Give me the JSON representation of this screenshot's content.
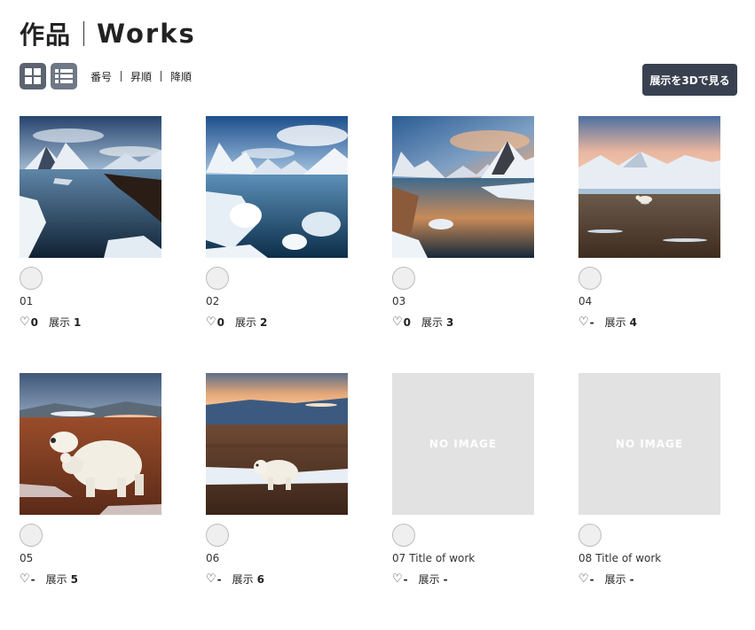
{
  "header": {
    "title_jp": "作品",
    "title_en": "Works"
  },
  "toolbar": {
    "grid_view_icon": "grid-icon",
    "list_view_icon": "list-icon",
    "sort_options": [
      "番号",
      "昇順",
      "降順"
    ],
    "view_3d_label": "展示を3Dで見る"
  },
  "works": [
    {
      "number": "01",
      "title": "",
      "likes": "0",
      "exhibit_label": "展示",
      "exhibit": "1",
      "image": "icy-lake-mountains"
    },
    {
      "number": "02",
      "title": "",
      "likes": "0",
      "exhibit_label": "展示",
      "exhibit": "2",
      "image": "ice-floes-mountains"
    },
    {
      "number": "03",
      "title": "",
      "likes": "0",
      "exhibit_label": "展示",
      "exhibit": "3",
      "image": "sunset-lake-mountains"
    },
    {
      "number": "04",
      "title": "",
      "likes": "-",
      "exhibit_label": "展示",
      "exhibit": "4",
      "image": "polar-bear-tundra"
    },
    {
      "number": "05",
      "title": "",
      "likes": "-",
      "exhibit_label": "展示",
      "exhibit": "5",
      "image": "polar-bear-mother-cub"
    },
    {
      "number": "06",
      "title": "",
      "likes": "-",
      "exhibit_label": "展示",
      "exhibit": "6",
      "image": "polar-bear-dusk"
    },
    {
      "number": "07",
      "title": "Title of work",
      "likes": "-",
      "exhibit_label": "展示",
      "exhibit": "-",
      "image": "no-image",
      "no_image_text": "NO IMAGE"
    },
    {
      "number": "08",
      "title": "Title of work",
      "likes": "-",
      "exhibit_label": "展示",
      "exhibit": "-",
      "image": "no-image",
      "no_image_text": "NO IMAGE"
    }
  ],
  "heart_icon": "heart-outline-icon",
  "heart_glyph": "♡"
}
